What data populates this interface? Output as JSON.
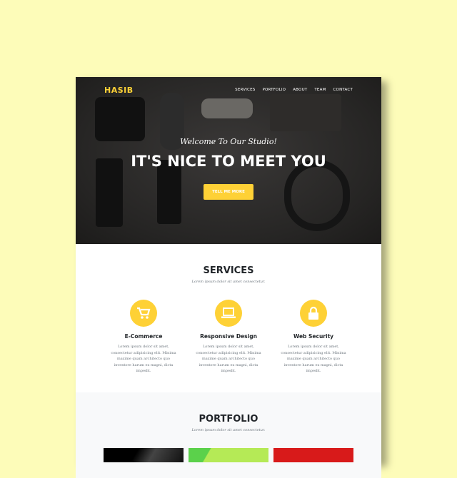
{
  "nav": {
    "logo": "HASIB",
    "items": [
      "SERVICES",
      "PORTFOLIO",
      "ABOUT",
      "TEAM",
      "CONTACT"
    ]
  },
  "hero": {
    "welcome": "Welcome To Our Studio!",
    "headline": "IT'S NICE TO MEET YOU",
    "button": "TELL ME MORE"
  },
  "services": {
    "title": "SERVICES",
    "subtitle": "Lorem ipsum dolor sit amet consectetur.",
    "items": [
      {
        "title": "E-Commerce",
        "icon": "shopping-cart-icon",
        "text": "Lorem ipsum dolor sit amet, consectetur adipisicing elit. Minima maxime quam architecto quo inventore harum ex magni, dicta impedit."
      },
      {
        "title": "Responsive Design",
        "icon": "laptop-icon",
        "text": "Lorem ipsum dolor sit amet, consectetur adipisicing elit. Minima maxime quam architecto quo inventore harum ex magni, dicta impedit."
      },
      {
        "title": "Web Security",
        "icon": "lock-icon",
        "text": "Lorem ipsum dolor sit amet, consectetur adipisicing elit. Minima maxime quam architecto quo inventore harum ex magni, dicta impedit."
      }
    ]
  },
  "portfolio": {
    "title": "PORTFOLIO",
    "subtitle": "Lorem ipsum dolor sit amet consectetur."
  },
  "colors": {
    "accent": "#fed136",
    "background": "#fdfcb9"
  }
}
